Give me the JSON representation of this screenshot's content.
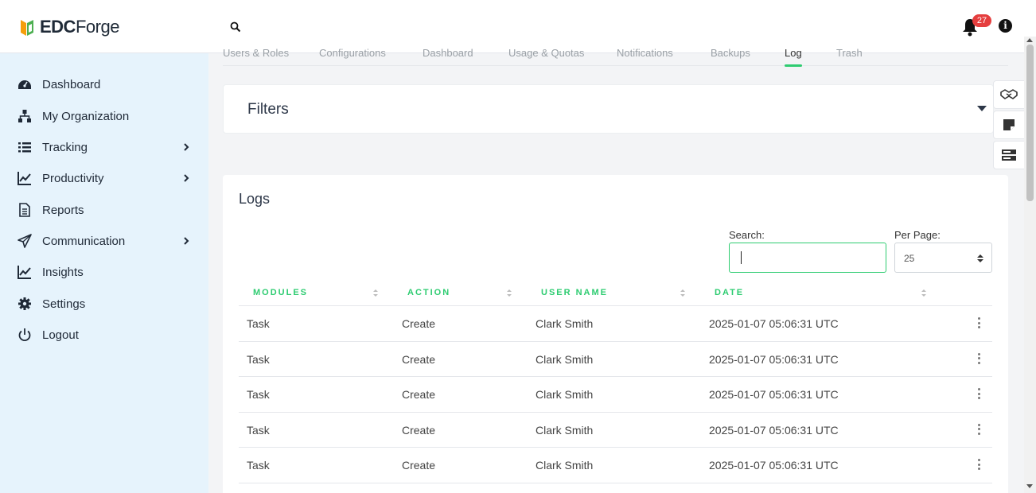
{
  "app": {
    "brand_part1": "EDC",
    "brand_part2": "Forge",
    "notification_count": "27",
    "info_glyph": "i"
  },
  "sidebar": {
    "items": [
      {
        "label": "Dashboard",
        "icon": "dashboard-gauge-icon"
      },
      {
        "label": "My Organization",
        "icon": "org-tree-icon"
      },
      {
        "label": "Tracking",
        "icon": "list-icon",
        "expandable": true
      },
      {
        "label": "Productivity",
        "icon": "trend-chart-icon",
        "expandable": true
      },
      {
        "label": "Reports",
        "icon": "document-icon"
      },
      {
        "label": "Communication",
        "icon": "paper-plane-icon",
        "expandable": true
      },
      {
        "label": "Insights",
        "icon": "trend-chart-icon"
      },
      {
        "label": "Settings",
        "icon": "gear-icon"
      },
      {
        "label": "Logout",
        "icon": "power-icon"
      }
    ]
  },
  "tabs": [
    {
      "label": "Users & Roles"
    },
    {
      "label": "Configurations"
    },
    {
      "label": "Dashboard"
    },
    {
      "label": "Usage & Quotas"
    },
    {
      "label": "Notifications"
    },
    {
      "label": "Backups"
    },
    {
      "label": "Log",
      "active": true
    },
    {
      "label": "Trash"
    }
  ],
  "filters": {
    "title": "Filters"
  },
  "logs": {
    "title": "Logs",
    "search_label": "Search:",
    "search_value": "",
    "per_page_label": "Per Page:",
    "per_page_value": "25",
    "columns": [
      "MODULES",
      "ACTION",
      "USER NAME",
      "DATE"
    ],
    "rows": [
      {
        "module": "Task",
        "action": "Create",
        "user": "Clark Smith",
        "date": "2025-01-07 05:06:31 UTC"
      },
      {
        "module": "Task",
        "action": "Create",
        "user": "Clark Smith",
        "date": "2025-01-07 05:06:31 UTC"
      },
      {
        "module": "Task",
        "action": "Create",
        "user": "Clark Smith",
        "date": "2025-01-07 05:06:31 UTC"
      },
      {
        "module": "Task",
        "action": "Create",
        "user": "Clark Smith",
        "date": "2025-01-07 05:06:31 UTC"
      },
      {
        "module": "Task",
        "action": "Create",
        "user": "Clark Smith",
        "date": "2025-01-07 05:06:31 UTC"
      }
    ]
  },
  "colors": {
    "accent": "#2ecc71",
    "sidebar_bg": "#e6f3fc",
    "badge": "#e53e3e",
    "logo_green": "#4caf50",
    "logo_orange": "#f59e0b"
  }
}
